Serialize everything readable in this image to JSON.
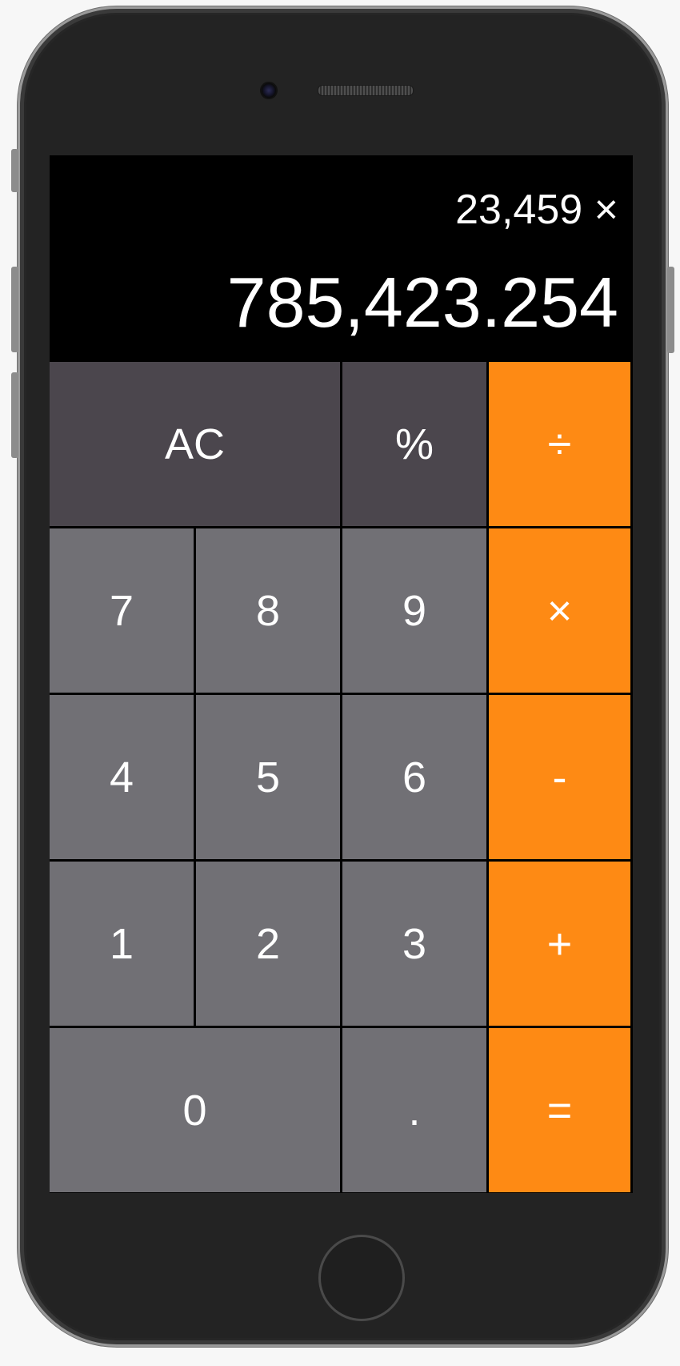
{
  "display": {
    "expression": "23,459 ×",
    "result": "785,423.254"
  },
  "keypad": {
    "keys": [
      {
        "label": "AC",
        "kind": "function"
      },
      {
        "label": "%",
        "kind": "function"
      },
      {
        "label": "÷",
        "kind": "operator"
      },
      {
        "label": "7",
        "kind": "number"
      },
      {
        "label": "8",
        "kind": "number"
      },
      {
        "label": "9",
        "kind": "number"
      },
      {
        "label": "×",
        "kind": "operator"
      },
      {
        "label": "4",
        "kind": "number"
      },
      {
        "label": "5",
        "kind": "number"
      },
      {
        "label": "6",
        "kind": "number"
      },
      {
        "label": "-",
        "kind": "operator"
      },
      {
        "label": "1",
        "kind": "number"
      },
      {
        "label": "2",
        "kind": "number"
      },
      {
        "label": "3",
        "kind": "number"
      },
      {
        "label": "+",
        "kind": "operator"
      },
      {
        "label": "0",
        "kind": "number"
      },
      {
        "label": ".",
        "kind": "number"
      },
      {
        "label": "=",
        "kind": "operator"
      }
    ]
  },
  "colors": {
    "function_key": "#4b464d",
    "number_key": "#717075",
    "operator_key": "#fe8a14",
    "display_background": "#000000",
    "text": "#ffffff"
  },
  "device": {
    "camera_icon": "front-camera-icon",
    "speaker_icon": "earpiece-speaker-icon",
    "home_button_icon": "home-button-icon"
  }
}
